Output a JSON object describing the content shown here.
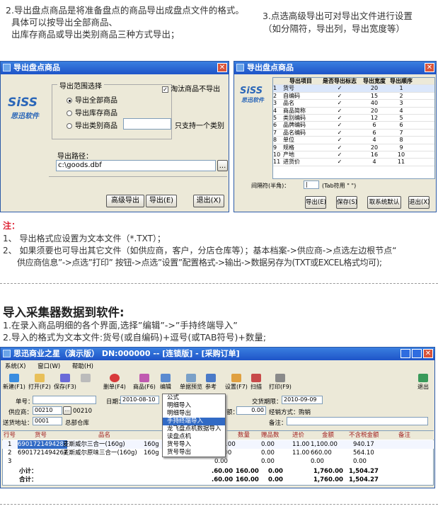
{
  "intro": {
    "left_line1": "2.导出盘点商品是将准备盘点的商品导出成盘点文件的格式。",
    "left_line2": "具体可以按导出全部商品、",
    "left_line3": "出库存商品或导出类别商品三种方式导出；",
    "right_line1": "3.点选高级导出可对导出文件进行设置",
    "right_line2": "（如分隔符，导出列，导出宽度等）"
  },
  "dialog1": {
    "title": "导出盘点商品",
    "close": "✕",
    "logo_text": "SiSS",
    "logo_sub": "思迅软件",
    "group_label": "导出范围选择",
    "option_all": "导出全部商品",
    "option_stock": "导出库存商品",
    "option_category": "导出类别商品",
    "checkbox_label": "淘汰商品不导出",
    "checkbox_mark": "✓",
    "category_hint": "只支持一个类别",
    "path_label": "导出路径：",
    "path_value": "c:\\goods.dbf",
    "browse": "...",
    "btn_advanced": "高级导出",
    "btn_export": "导出(E)",
    "btn_exit": "退出(X)"
  },
  "dialog2": {
    "title": "导出盘点商品",
    "close": "✕",
    "logo_text": "SiSS",
    "logo_sub": "思迅软件",
    "headers": [
      "",
      "导出项目",
      "是否导出标志",
      "导出宽度",
      "导出顺序"
    ],
    "rows": [
      [
        "1",
        "货号",
        "✓",
        "20",
        "1"
      ],
      [
        "2",
        "自编码",
        "✓",
        "15",
        "2"
      ],
      [
        "3",
        "品名",
        "✓",
        "40",
        "3"
      ],
      [
        "4",
        "商品简称",
        "✓",
        "20",
        "4"
      ],
      [
        "5",
        "类别编码",
        "✓",
        "12",
        "5"
      ],
      [
        "6",
        "品牌编码",
        "✓",
        "6",
        "6"
      ],
      [
        "7",
        "品名编码",
        "✓",
        "6",
        "7"
      ],
      [
        "8",
        "单位",
        "✓",
        "4",
        "8"
      ],
      [
        "9",
        "规格",
        "✓",
        "20",
        "9"
      ],
      [
        "10",
        "产地",
        "✓",
        "16",
        "10"
      ],
      [
        "11",
        "进货价",
        "✓",
        "4",
        "11"
      ]
    ],
    "separator_label": "间隔符(半角)：",
    "separator_value": "|",
    "tab_hint": "(Tab符用 \" \")",
    "btn_export": "导出(E)",
    "btn_save": "保存(S)",
    "btn_default": "取系统默认",
    "btn_exit": "退出(X)"
  },
  "notes": {
    "title": "注：",
    "line1": "1、 导出格式应设置为文本文件（*.TXT）；",
    "line2": "2、 如果须要也可导出其它文件（如供应商，客户，分店仓库等）；基本档案->供应商->点选左边根节点“",
    "line3": "供应商信息”->点选”打印” 按钮->点选”设置”配置格式->输出->数据另存为(TXT或EXCEL格式均可);"
  },
  "section2": {
    "heading": "导入采集器数据到软件:",
    "line1": "1.在录入商品明细的各个界面,选择”编辑”->”手持终端导入”",
    "line2": "2.导入的格式为文本文件:货号(或自编码)+逗号(或TAB符号)+数量;"
  },
  "app": {
    "title": "思迅商业之星（演示版） DN:000000 -- [连锁版] - [采购订单]",
    "menu_items": [
      "系统(X)",
      "窗口(W)",
      "帮助(H)"
    ],
    "toolbar": [
      "新建(F1)",
      "打开(F2)",
      "保存(F3)",
      "",
      "删单(F4)",
      "商品(F6)",
      "编辑",
      "单据预览",
      "参考",
      "设置(F7)",
      "扫描",
      "打印(F9)"
    ],
    "exit": "退出",
    "order_no_label": "单号：",
    "date_label": "日期：",
    "date_value": "2010-08-10",
    "delivery_label": "交货期限：",
    "delivery_value": "2010-09-09",
    "supplier_label": "供应商：",
    "supplier_code": "00210",
    "supplier_code2": "00210",
    "amount_label": "额：",
    "amount_value": "0.00",
    "method_label": "经销方式：",
    "method_value": "购销",
    "warehouse_label": "送货地址：",
    "warehouse_code": "0001",
    "warehouse_name": "总部仓库",
    "remark_label": "备注：",
    "edit_menu": [
      "公式",
      "明细导入",
      "明细导出",
      "手持终端导入",
      "龙飞盘点机数据导入",
      "读盘点机",
      "货号导入",
      "货号导出"
    ],
    "table_headers": [
      "行号",
      "货号",
      "品名",
      "",
      "数量",
      "赠品数",
      "进价",
      "金额",
      "不含税金额",
      "备注"
    ],
    "table_rows": [
      [
        "1",
        "6901721494281",
        "麦斯威尔三合一(160g)",
        "160g",
        "100.00",
        "0.00",
        "11.00",
        "1,100.00",
        "940.17",
        ""
      ],
      [
        "2",
        "6901721494267",
        "麦斯威尔原味三合一(160g)",
        "160g",
        "60.00",
        "0.00",
        "11.00",
        "660.00",
        "564.10",
        ""
      ],
      [
        "3",
        "",
        "",
        "",
        "0.00",
        "0.00",
        "",
        "0.00",
        "0.00",
        ""
      ]
    ],
    "subtotal_label": "小计：",
    "total_label": "合计：",
    "subtotal": [
      ".60.00",
      "160.00",
      "0.00",
      "",
      "1,760.00",
      "1,504.27"
    ],
    "total": [
      ".60.00",
      "160.00",
      "0.00",
      "",
      "1,760.00",
      "1,504.27"
    ]
  },
  "colors": {
    "title_blue": "#1e54c8",
    "accent_red": "#d23",
    "window_bg": "#ece9d8",
    "selection": "#316ac5"
  }
}
